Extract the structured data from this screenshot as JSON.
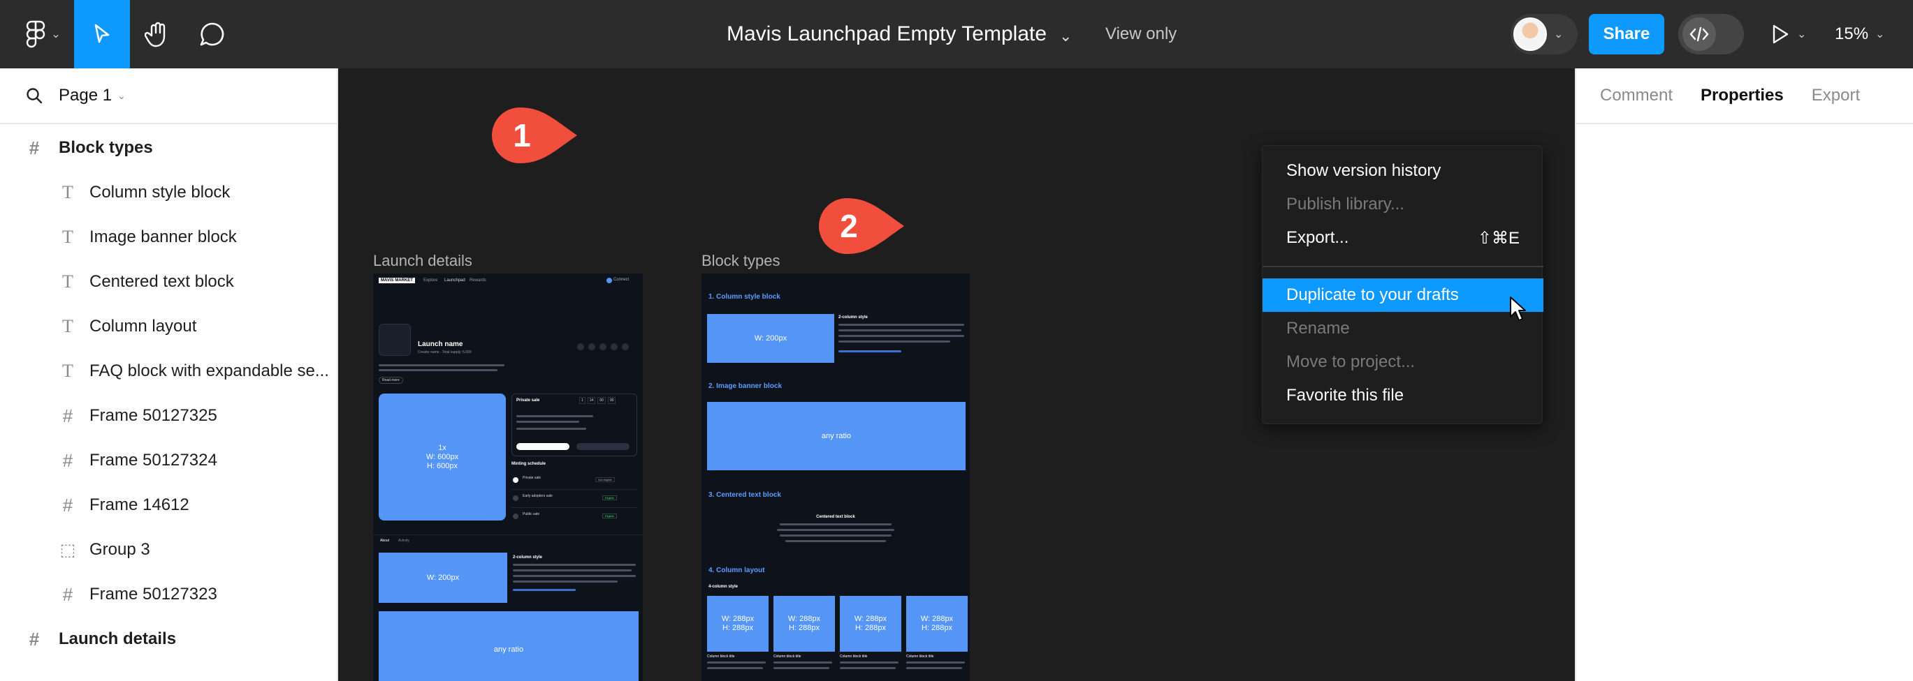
{
  "header": {
    "file_title": "Mavis Launchpad Empty Template",
    "view_mode": "View only",
    "share_label": "Share",
    "zoom": "15%",
    "icons": [
      "figma-logo-icon",
      "move-tool-icon",
      "hand-tool-icon",
      "comment-tool-icon",
      "dev-mode-icon",
      "present-icon"
    ]
  },
  "left_panel": {
    "page_name": "Page 1",
    "layers": [
      {
        "label": "Block types",
        "level": "top",
        "icon": "frame-icon"
      },
      {
        "label": "Column style block",
        "level": "child",
        "icon": "text-icon"
      },
      {
        "label": "Image banner block",
        "level": "child",
        "icon": "text-icon"
      },
      {
        "label": "Centered text block",
        "level": "child",
        "icon": "text-icon"
      },
      {
        "label": "Column layout",
        "level": "child",
        "icon": "text-icon"
      },
      {
        "label": "FAQ block with expandable se...",
        "level": "child",
        "icon": "text-icon"
      },
      {
        "label": "Frame 50127325",
        "level": "child",
        "icon": "frame-icon"
      },
      {
        "label": "Frame 50127324",
        "level": "child",
        "icon": "frame-icon"
      },
      {
        "label": "Frame 14612",
        "level": "child",
        "icon": "frame-icon"
      },
      {
        "label": "Group 3",
        "level": "child",
        "icon": "group-icon"
      },
      {
        "label": "Frame 50127323",
        "level": "child",
        "icon": "frame-icon"
      },
      {
        "label": "Launch details",
        "level": "top",
        "icon": "frame-icon"
      }
    ]
  },
  "canvas": {
    "frames": [
      {
        "label": "Launch details"
      },
      {
        "label": "Block types"
      }
    ],
    "launch_frame": {
      "nav_brand": "MAVIS MARKET",
      "nav_items": [
        "Explore",
        "Launchpad",
        "Rewards"
      ],
      "connect": "Connect",
      "launch_name": "Launch name",
      "meta": "Creator name  ·  Total supply: 5,000",
      "read_more": "Read more",
      "image_text": "1x\nW: 600px\nH: 600px",
      "private_sale": "Private sale",
      "countdown": [
        "1",
        "14",
        "00",
        "00"
      ],
      "minting_schedule": "Minting schedule",
      "schedule": [
        {
          "name": "Private sale",
          "status": "Not eligible"
        },
        {
          "name": "Early adopters sale",
          "status": "Eligible"
        },
        {
          "name": "Public sale",
          "status": "Eligible"
        }
      ],
      "tabs": [
        "About",
        "Activity"
      ],
      "block_w200": "W: 200px",
      "two_col": "2-column style",
      "any_ratio": "any ratio"
    },
    "block_frame": {
      "sections": [
        "1. Column style block",
        "2. Image banner block",
        "3. Centered text block",
        "4. Column layout"
      ],
      "w200": "W: 200px",
      "two_col": "2-column style",
      "any_ratio": "any ratio",
      "centered_title": "Centered text block",
      "four_col": "4-column style",
      "tile_text": "W: 288px\nH: 288px",
      "col_caption": "Column block title"
    },
    "badges": [
      "1",
      "2"
    ]
  },
  "context_menu": {
    "items": [
      {
        "label": "Show version history",
        "state": "enabled",
        "shortcut": ""
      },
      {
        "label": "Publish library...",
        "state": "disabled",
        "shortcut": ""
      },
      {
        "label": "Export...",
        "state": "enabled",
        "shortcut": "⇧⌘E"
      },
      {
        "label": "Duplicate to your drafts",
        "state": "highlighted",
        "shortcut": ""
      },
      {
        "label": "Rename",
        "state": "disabled",
        "shortcut": ""
      },
      {
        "label": "Move to project...",
        "state": "disabled",
        "shortcut": ""
      },
      {
        "label": "Favorite this file",
        "state": "enabled",
        "shortcut": ""
      }
    ]
  },
  "right_panel": {
    "tabs": [
      "Comment",
      "Properties",
      "Export"
    ],
    "active_tab": "Properties"
  },
  "colors": {
    "accent": "#0d99ff",
    "topbar": "#2c2c2c",
    "canvas": "#1e1e1e",
    "badge": "#f24e3d",
    "block_blue": "#5495f5"
  }
}
